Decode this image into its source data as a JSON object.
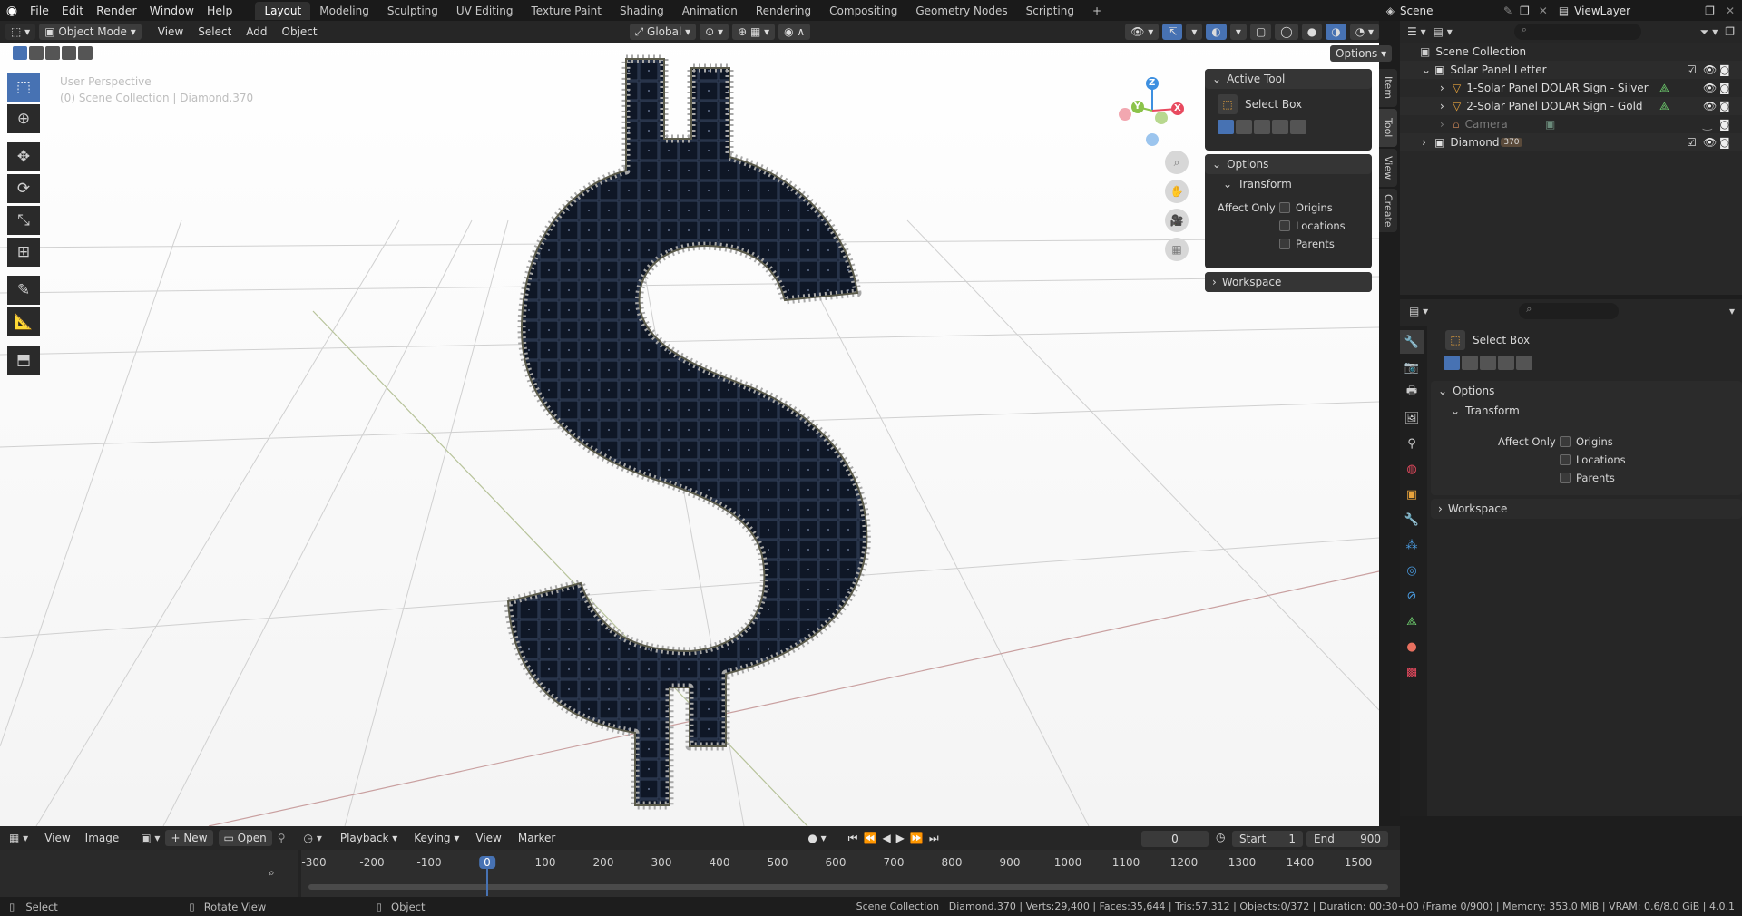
{
  "menu": {
    "items": [
      "File",
      "Edit",
      "Render",
      "Window",
      "Help"
    ],
    "workspaces": [
      "Layout",
      "Modeling",
      "Sculpting",
      "UV Editing",
      "Texture Paint",
      "Shading",
      "Animation",
      "Rendering",
      "Compositing",
      "Geometry Nodes",
      "Scripting"
    ],
    "active_workspace": "Layout",
    "scene_label": "Scene",
    "view_layer_label": "ViewLayer"
  },
  "viewport_header": {
    "mode": "Object Mode",
    "menus": [
      "View",
      "Select",
      "Add",
      "Object"
    ],
    "orientation": "Global",
    "options_label": "Options"
  },
  "viewport": {
    "perspective": "User Perspective",
    "context": "(0) Scene Collection | Diamond.370",
    "gizmo_x": "X",
    "gizmo_y": "Y",
    "gizmo_z": "Z",
    "sidebar_tabs": [
      "Item",
      "Tool",
      "View",
      "Create"
    ]
  },
  "npanel": {
    "active_tool_title": "Active Tool",
    "tool_name": "Select Box",
    "options_title": "Options",
    "transform_title": "Transform",
    "affect_only": "Affect Only",
    "checkboxes": [
      "Origins",
      "Locations",
      "Parents"
    ],
    "workspace_title": "Workspace"
  },
  "outliner": {
    "root": "Scene Collection",
    "rows": [
      {
        "label": "Solar Panel Letter",
        "indent": 1
      },
      {
        "label": "1-Solar Panel DOLAR Sign - Silver",
        "indent": 2
      },
      {
        "label": "2-Solar Panel DOLAR Sign - Gold",
        "indent": 2
      },
      {
        "label": "Camera",
        "indent": 2
      },
      {
        "label": "Diamond",
        "indent": 1
      }
    ],
    "diamond_badge": "370"
  },
  "properties": {
    "tool_name": "Select Box",
    "options_title": "Options",
    "transform_title": "Transform",
    "affect_only": "Affect Only",
    "checkboxes": [
      "Origins",
      "Locations",
      "Parents"
    ],
    "workspace_title": "Workspace"
  },
  "timeline": {
    "menus": [
      "Playback",
      "Keying",
      "View",
      "Marker"
    ],
    "image_menus": [
      "View",
      "Image"
    ],
    "new_label": "New",
    "open_label": "Open",
    "current_frame": "0",
    "start_label": "Start",
    "start_value": "1",
    "end_label": "End",
    "end_value": "900",
    "ticks": [
      "-300",
      "-200",
      "-100",
      "0",
      "100",
      "200",
      "300",
      "400",
      "500",
      "600",
      "700",
      "800",
      "900",
      "1000",
      "1100",
      "1200",
      "1300",
      "1400",
      "1500"
    ]
  },
  "statusbar": {
    "select": "Select",
    "rotate_view": "Rotate View",
    "object": "Object",
    "stats": "Scene Collection | Diamond.370 | Verts:29,400 | Faces:35,644 | Tris:57,312 | Objects:0/372 | Duration: 00:30+00 (Frame 0/900) | Memory: 353.0 MiB | VRAM: 0.6/8.0 GiB | 4.0.1"
  },
  "colors": {
    "accent": "#4772b3",
    "active_tab": "#303030",
    "gizmo_x": "#e84a5f",
    "gizmo_y": "#8bc34a",
    "gizmo_z": "#3d8fe0"
  }
}
